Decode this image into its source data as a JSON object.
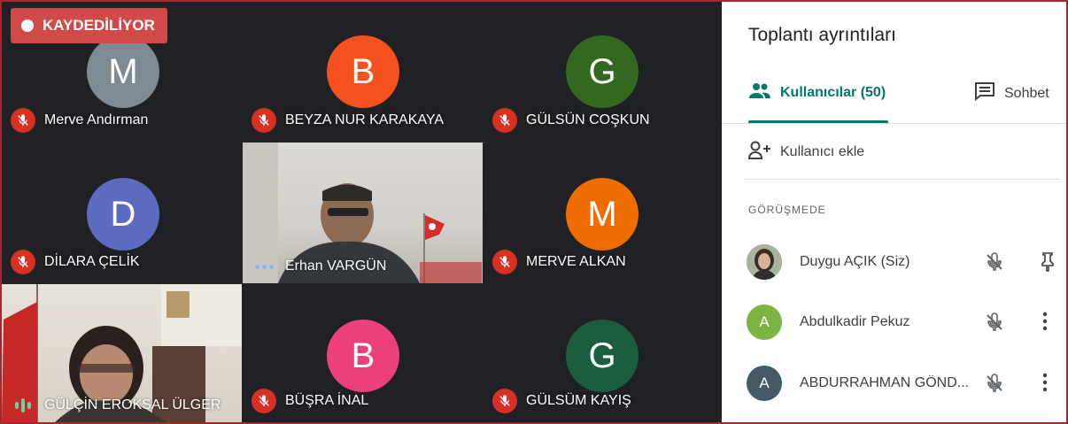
{
  "recording": {
    "label": "KAYDEDİLİYOR"
  },
  "tiles": [
    {
      "name": "Merve Andırman",
      "initial": "M",
      "color": "#7d8b94"
    },
    {
      "name": "BEYZA NUR KARAKAYA",
      "initial": "B",
      "color": "#f4511e"
    },
    {
      "name": "GÜLSÜN COŞKUN",
      "initial": "G",
      "color": "#33691e"
    },
    {
      "name": "DİLARA ÇELİK",
      "initial": "D",
      "color": "#5c6bc0"
    },
    {
      "name": "Erhan VARGÜN",
      "initial": "",
      "color": ""
    },
    {
      "name": "MERVE ALKAN",
      "initial": "M",
      "color": "#ef6c00"
    },
    {
      "name": "GÜLÇİN EROKSAL ÜLGER",
      "initial": "",
      "color": ""
    },
    {
      "name": "BÜŞRA İNAL",
      "initial": "B",
      "color": "#ec407a"
    },
    {
      "name": "GÜLSÜM KAYIŞ",
      "initial": "G",
      "color": "#1b5e3f"
    }
  ],
  "panel": {
    "title": "Toplantı ayrıntıları",
    "tabs": {
      "people": "Kullanıcılar (50)",
      "chat": "Sohbet"
    },
    "add_people": "Kullanıcı ekle",
    "section_label": "GÖRÜŞMEDE",
    "participants": [
      {
        "name": "Duygu AÇIK (Siz)",
        "initial": "",
        "color": "#8d6e63",
        "action_icon": "pin-icon"
      },
      {
        "name": "Abdulkadir Pekuz",
        "initial": "A",
        "color": "#7cb342",
        "action_icon": "more-vert-icon"
      },
      {
        "name": "ABDURRAHMAN GÖND...",
        "initial": "A",
        "color": "#455a64",
        "action_icon": "more-vert-icon"
      }
    ]
  },
  "colors": {
    "accent": "#00796b",
    "mute": "#d93025",
    "recording": "#d14a4a"
  }
}
